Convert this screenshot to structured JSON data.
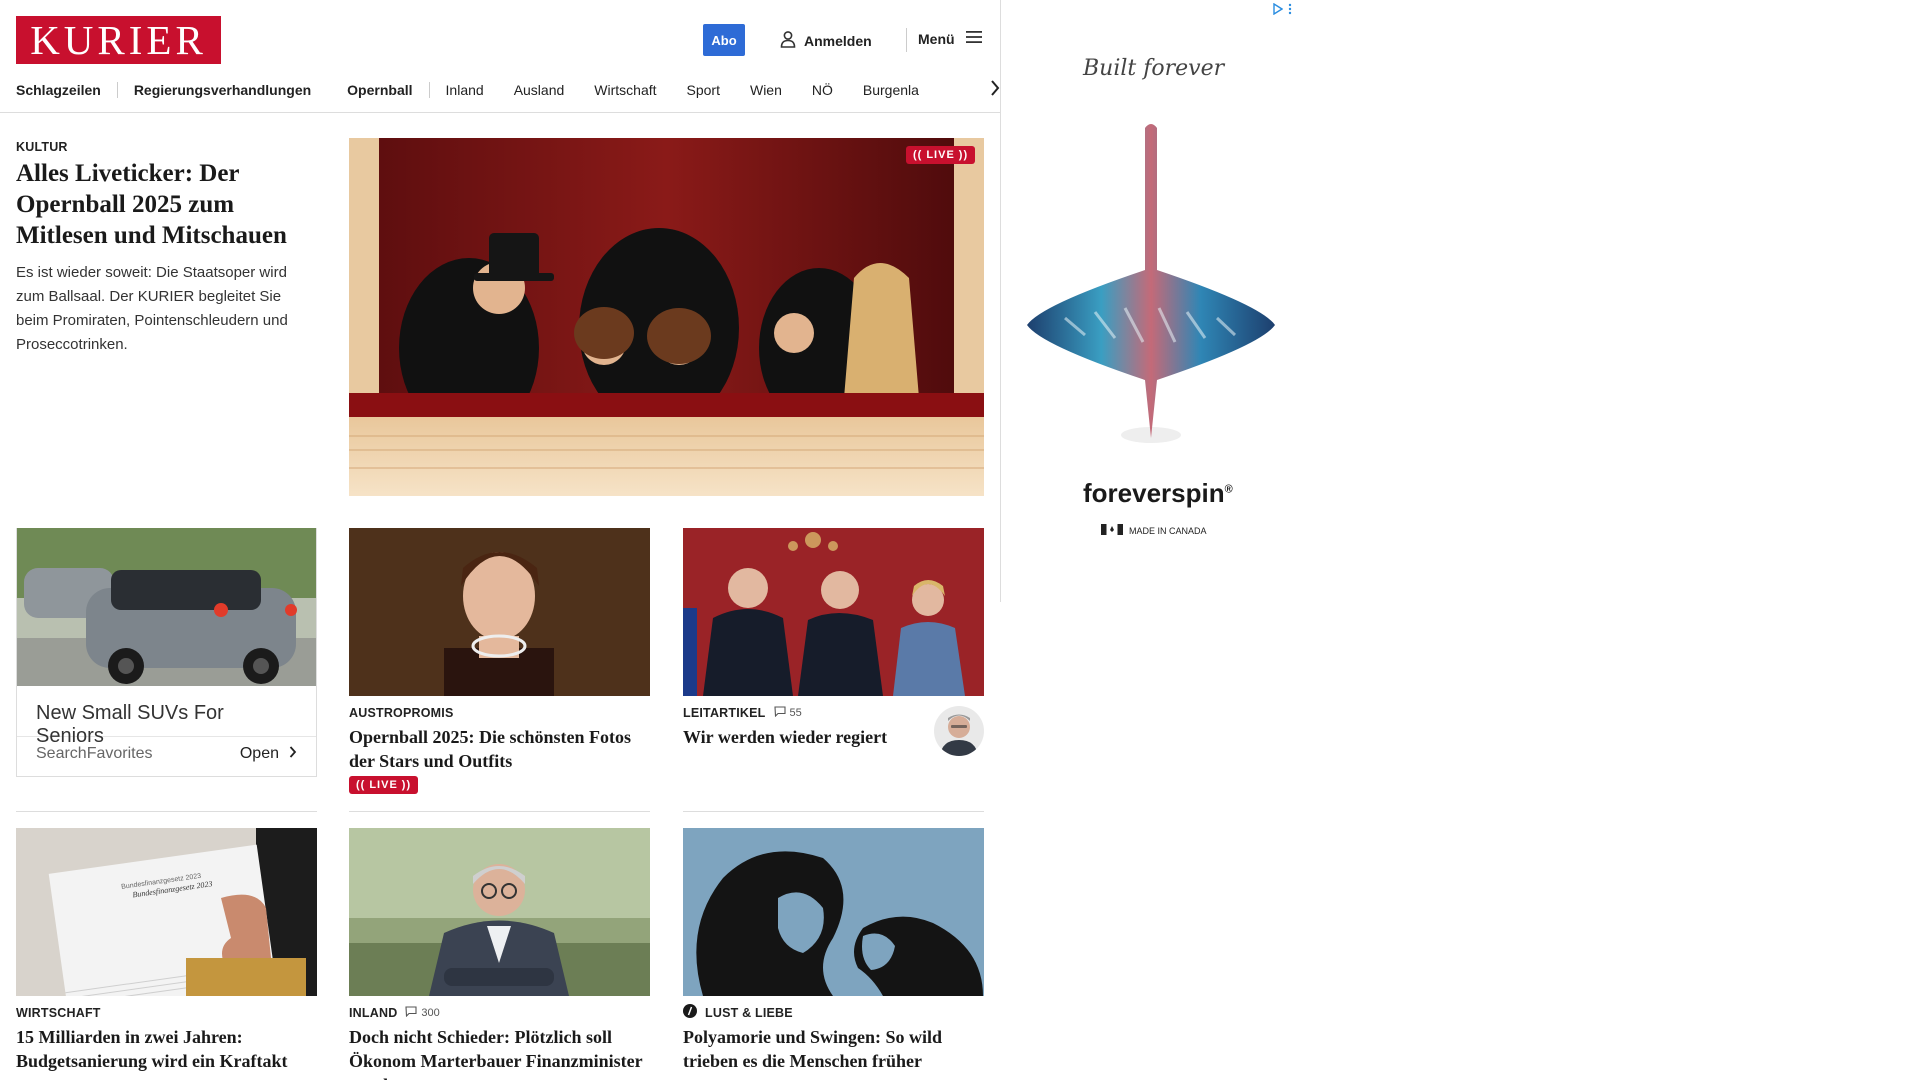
{
  "header": {
    "logo": "KURIER",
    "abo": "Abo",
    "login": "Anmelden",
    "menu": "Menü"
  },
  "nav": [
    "Schlagzeilen",
    "Regierungsverhandlungen",
    "Opernball",
    "Inland",
    "Ausland",
    "Wirtschaft",
    "Sport",
    "Wien",
    "NÖ",
    "Burgenla"
  ],
  "lead": {
    "kicker": "KULTUR",
    "title": "Alles Liveticker: Der Opernball 2025 zum Mitlesen und Mitschauen",
    "teaser": "Es ist wieder soweit: Die Staatsoper wird zum Ballsaal. Der KURIER begleitet Sie beim Promiraten, Pointenschleudern und Proseccotrinken.",
    "badge": "LIVE"
  },
  "sponsored": {
    "headline": "New Small SUVs For Seniors",
    "source": "SearchFavorites",
    "cta": "Open"
  },
  "cards": [
    {
      "kicker": "AUSTROPROMIS",
      "title": "Opernball 2025: Die schönsten Fotos der Stars und Outfits",
      "badge": "LIVE"
    },
    {
      "kicker": "LEITARTIKEL",
      "comments": "55",
      "title": "Wir werden wieder regiert"
    },
    {
      "kicker": "WIRTSCHAFT",
      "title": "15 Milliarden in zwei Jahren: Budgetsanierung wird ein Kraftakt"
    },
    {
      "kicker": "INLAND",
      "comments": "300",
      "title": "Doch nicht Schieder: Plötzlich soll Ökonom Marterbauer Finanzminister werden"
    },
    {
      "kicker": "LUST & LIEBE",
      "title": "Polyamorie und Swingen: So wild trieben es die Menschen früher"
    }
  ],
  "image_labels": {
    "budget_book_line1": "Bundesfinanzgesetz 2023",
    "budget_book_line2": "Bundesfinanzgesetz 2023"
  },
  "side_ad": {
    "tagline": "Built forever",
    "brand": "foreverspin",
    "origin": "MADE IN CANADA"
  },
  "colors": {
    "brand_red": "#c8102e",
    "abo_blue": "#2e6bd6"
  }
}
